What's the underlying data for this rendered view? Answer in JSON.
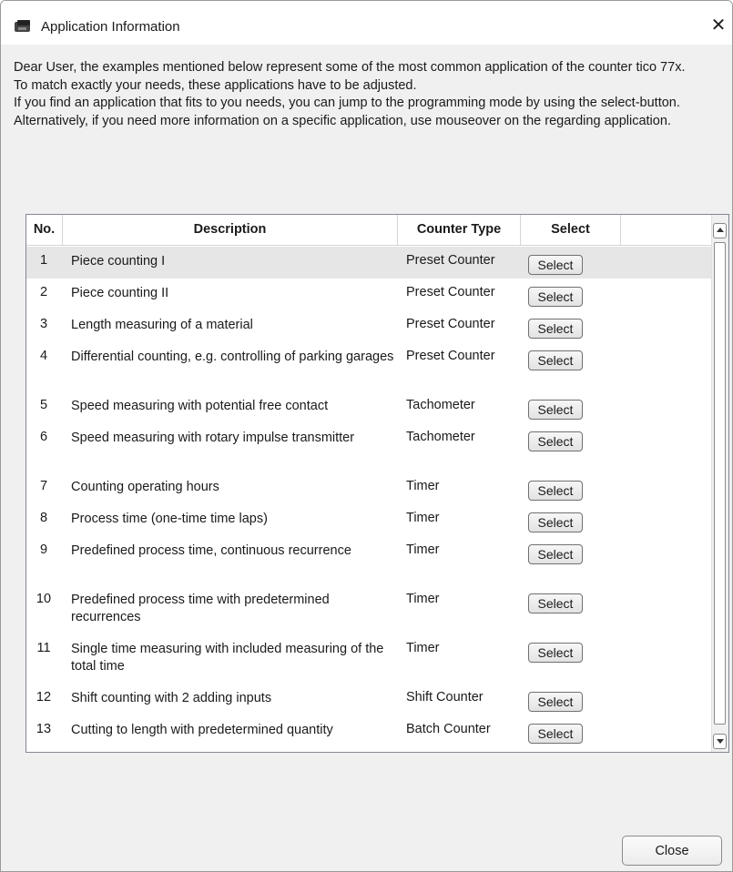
{
  "window": {
    "title": "Application Information",
    "close_glyph": "✕"
  },
  "intro": [
    "Dear User, the examples mentioned below represent some of the most common application of the counter tico 77x.",
    "To match exactly your needs, these applications have to be adjusted.",
    "If you find an application that fits to you needs, you can jump to the programming mode by using the select-button.",
    "Alternatively, if you need more information on a specific application, use mouseover on the regarding application."
  ],
  "grid": {
    "columns": [
      "No.",
      "Description",
      "Counter Type",
      "Select"
    ],
    "selected_row": 1,
    "rows": [
      {
        "no": "1",
        "description": "Piece counting I",
        "type": "Preset Counter",
        "action": "Select"
      },
      {
        "no": "2",
        "description": "Piece counting II",
        "type": "Preset Counter",
        "action": "Select"
      },
      {
        "no": "3",
        "description": "Length measuring of a material",
        "type": "Preset Counter",
        "action": "Select"
      },
      {
        "no": "4",
        "description": "Differential counting, e.g. controlling of parking garages",
        "type": "Preset Counter",
        "action": "Select"
      },
      {
        "no": "5",
        "description": "Speed measuring with potential free contact",
        "type": "Tachometer",
        "action": "Select"
      },
      {
        "no": "6",
        "description": "Speed measuring with rotary impulse transmitter",
        "type": "Tachometer",
        "action": "Select"
      },
      {
        "no": "7",
        "description": "Counting operating hours",
        "type": "Timer",
        "action": "Select"
      },
      {
        "no": "8",
        "description": "Process time (one-time time laps)",
        "type": "Timer",
        "action": "Select"
      },
      {
        "no": "9",
        "description": "Predefined process time, continuous recurrence",
        "type": "Timer",
        "action": "Select"
      },
      {
        "no": "10",
        "description": "Predefined process time with predetermined recurrences",
        "type": "Timer",
        "action": "Select"
      },
      {
        "no": "11",
        "description": "Single time measuring with included measuring of the total time",
        "type": "Timer",
        "action": "Select"
      },
      {
        "no": "12",
        "description": "Shift counting with 2 adding inputs",
        "type": "Shift Counter",
        "action": "Select"
      },
      {
        "no": "13",
        "description": "Cutting to length with predetermined quantity",
        "type": "Batch Counter",
        "action": "Select"
      }
    ]
  },
  "footer": {
    "close_label": "Close"
  }
}
